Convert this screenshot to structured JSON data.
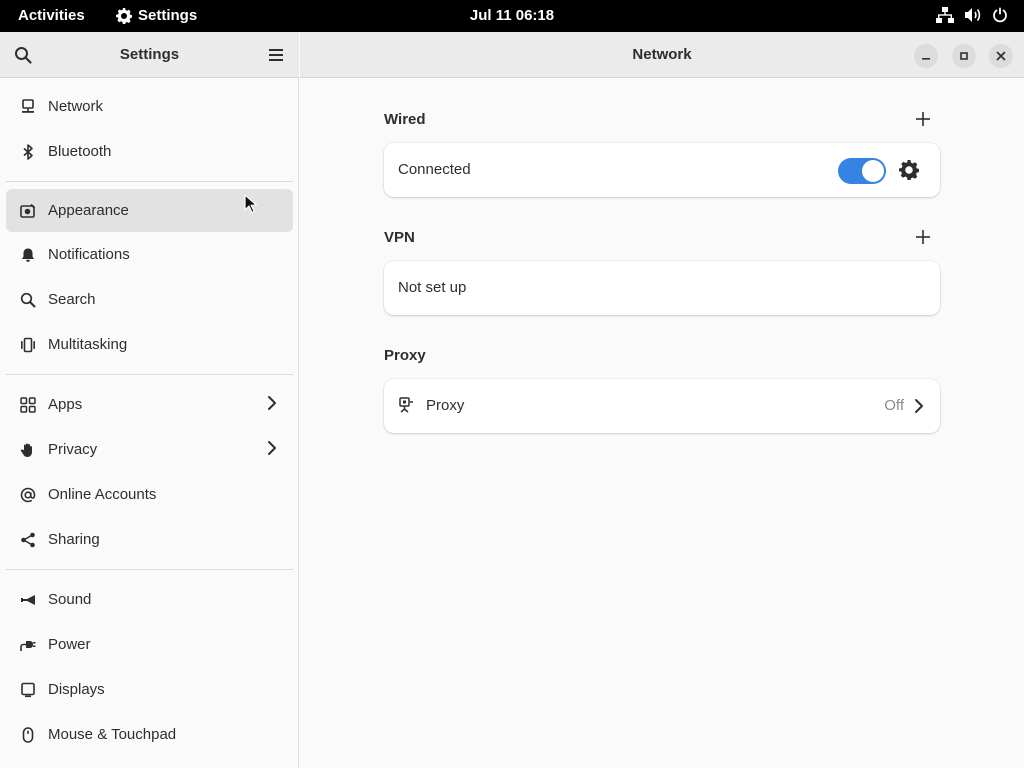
{
  "topbar": {
    "activities": "Activities",
    "app_name": "Settings",
    "clock": "Jul 11  06:18"
  },
  "sidebar": {
    "title": "Settings",
    "groups": [
      [
        {
          "label": "Network",
          "icon": "network-wired-icon"
        },
        {
          "label": "Bluetooth",
          "icon": "bluetooth-icon"
        }
      ],
      [
        {
          "label": "Appearance",
          "icon": "appearance-icon",
          "active": true
        },
        {
          "label": "Notifications",
          "icon": "bell-icon"
        },
        {
          "label": "Search",
          "icon": "search-icon"
        },
        {
          "label": "Multitasking",
          "icon": "multitasking-icon"
        }
      ],
      [
        {
          "label": "Apps",
          "icon": "apps-grid-icon",
          "chevron": true
        },
        {
          "label": "Privacy",
          "icon": "hand-icon",
          "chevron": true
        },
        {
          "label": "Online Accounts",
          "icon": "at-icon"
        },
        {
          "label": "Sharing",
          "icon": "share-icon"
        }
      ],
      [
        {
          "label": "Sound",
          "icon": "speaker-icon"
        },
        {
          "label": "Power",
          "icon": "power-plug-icon"
        },
        {
          "label": "Displays",
          "icon": "display-icon"
        },
        {
          "label": "Mouse & Touchpad",
          "icon": "mouse-icon"
        }
      ]
    ]
  },
  "content": {
    "title": "Network",
    "wired": {
      "title": "Wired",
      "status": "Connected",
      "toggle_on": true
    },
    "vpn": {
      "title": "VPN",
      "status": "Not set up"
    },
    "proxy": {
      "title": "Proxy",
      "label": "Proxy",
      "status": "Off"
    }
  },
  "colors": {
    "accent": "#3584e4",
    "topbar": "#000000",
    "header": "#ebebeb",
    "selected": "#e2e2e2"
  }
}
